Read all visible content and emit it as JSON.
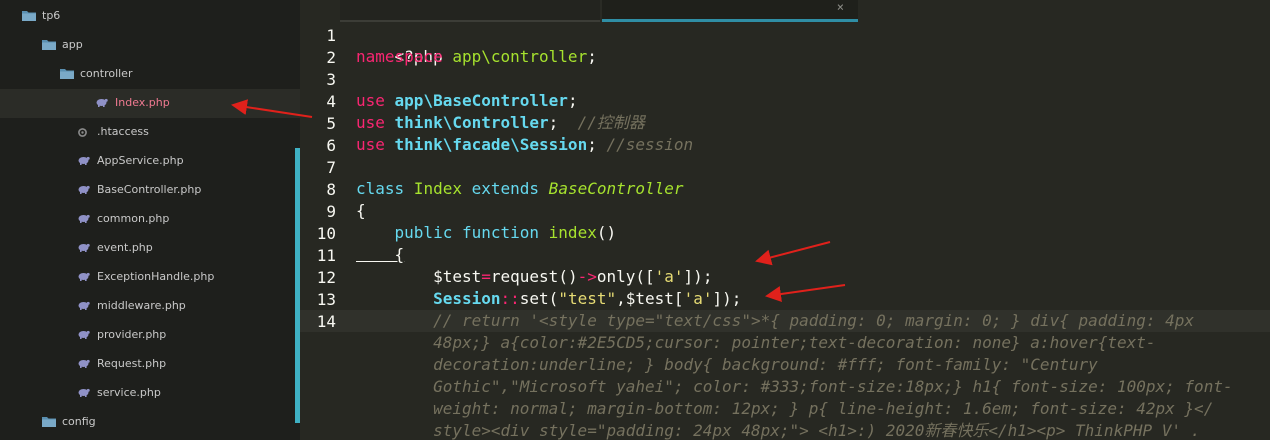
{
  "sidebar": {
    "items": [
      {
        "label": "tp6",
        "type": "folder"
      },
      {
        "label": "app",
        "type": "folder"
      },
      {
        "label": "controller",
        "type": "folder"
      },
      {
        "label": "Index.php",
        "type": "php-file",
        "selected": true
      },
      {
        "label": ".htaccess",
        "type": "config-file"
      },
      {
        "label": "AppService.php",
        "type": "php-file"
      },
      {
        "label": "BaseController.php",
        "type": "php-file"
      },
      {
        "label": "common.php",
        "type": "php-file"
      },
      {
        "label": "event.php",
        "type": "php-file"
      },
      {
        "label": "ExceptionHandle.php",
        "type": "php-file"
      },
      {
        "label": "middleware.php",
        "type": "php-file"
      },
      {
        "label": "provider.php",
        "type": "php-file"
      },
      {
        "label": "Request.php",
        "type": "php-file"
      },
      {
        "label": "service.php",
        "type": "php-file"
      },
      {
        "label": "config",
        "type": "folder"
      }
    ]
  },
  "editor": {
    "tab_close": "×",
    "line_numbers": [
      "1",
      "2",
      "3",
      "4",
      "5",
      "6",
      "7",
      "8",
      "9",
      "10",
      "11",
      "12",
      "13",
      "14"
    ],
    "lines": {
      "l1": [
        "<?php"
      ],
      "l2": [
        "namespace",
        " app\\controller",
        ";"
      ],
      "l4": [
        "use",
        " app\\BaseController",
        ";"
      ],
      "l5": [
        "use",
        " think\\Controller",
        ";  ",
        "//控制器"
      ],
      "l6": [
        "use",
        " think\\facade\\Session",
        "; ",
        "//session"
      ],
      "l8": [
        "class",
        " Index ",
        "extends",
        " BaseController"
      ],
      "l9": [
        "{"
      ],
      "l10": [
        "    public",
        " function",
        " index",
        "()"
      ],
      "l11": [
        "    {"
      ],
      "l12": [
        "        $test",
        "=",
        "request",
        "()",
        "->",
        "only",
        "([",
        "'a'",
        "]);"
      ],
      "l13": [
        "        Session",
        "::",
        "set",
        "(",
        "\"test\"",
        ",",
        "$test",
        "[",
        "'a'",
        "]);"
      ],
      "l14a": "        // return '<style type=\"text/css\">*{ padding: 0; margin: 0; } div{ padding: 4px",
      "l14b": "        48px;} a{color:#2E5CD5;cursor: pointer;text-decoration: none} a:hover{text-",
      "l14c": "        decoration:underline; } body{ background: #fff; font-family: \"Century",
      "l14d": "        Gothic\",\"Microsoft yahei\"; color: #333;font-size:18px;} h1{ font-size: 100px; font-",
      "l14e": "        weight: normal; margin-bottom: 12px; } p{ line-height: 1.6em; font-size: 42px }</",
      "l14f": "        style><div style=\"padding: 24px 48px;\"> <h1>:) 2020新春快乐</h1><p> ThinkPHP V' ."
    }
  },
  "colors": {
    "sidebar_bg": "#1e1f1c",
    "editor_bg": "#272822",
    "selected_file": "#f07a91",
    "scrollbar": "#3fb1c4",
    "annotation_arrow": "#e0211b"
  }
}
